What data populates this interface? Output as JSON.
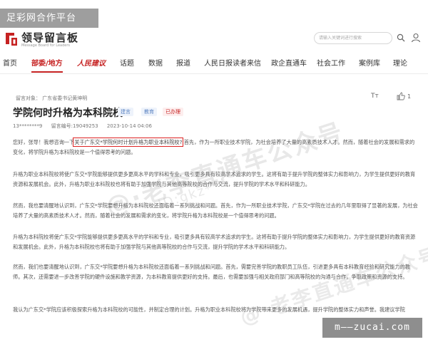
{
  "watermark_top": "足彩网合作平台",
  "watermark_bottom": "m——zucai.com",
  "watermark_overlay": {
    "line1": "@·老李直通车公众号",
    "line2": "ID:gkz***",
    "line3": "@·老李直通车公众号"
  },
  "header": {
    "logo_title": "领导留言板",
    "logo_sub": "Message Board for Leaders",
    "search_placeholder": "请输入关键词进行搜索",
    "logo_color": "#c62222"
  },
  "nav": {
    "items": [
      "首页",
      "部委/地方",
      "人民建议",
      "话题",
      "数据",
      "报道",
      "人民日报读者来信",
      "政企直通车",
      "社会工作",
      "案例库",
      "理论"
    ],
    "active_index": 1
  },
  "message": {
    "recipient": "留言对象：   广东省委书记黄坤明",
    "title": "学院何时升格为本科院校",
    "tags": [
      "建言",
      "教育",
      "已办理"
    ],
    "author": "13********9",
    "id": "留言编号:19049253",
    "time": "2023-10-14 04:06",
    "font_toggle": "Tт",
    "likes": "1",
    "paragraphs": [
      {
        "pre": "您好，张导！我想咨询一下",
        "highlight": "关于广东交*学院何时计划升格为职业本科院校?",
        "post": " 首先，作为一所职业技术学院，为社会培养了大量的高素质技术人才。然而，随着社会的发展和需求的变化，将学院升格为本科院校是一个值得思考的问题。"
      },
      {
        "pre": "升格为职业本科院校将使广东交*学院能够提供更多更高水平的学科和专业，吸引更多具有较高学术追求的学生。这将有助于提升学院的整体实力和影响力，为学生提供更好的教育资源和发展机会。此外，升格为职业本科院校也将有助于加强学院与其他高等院校的合作与交流，提升学院的学术水平和科研能力。",
        "highlight": "",
        "post": ""
      },
      {
        "pre": "然而，我也要清醒地认识到，广东交*学院要想升格为本科院校还面临着一系列挑战和问题。首先，作为一所职业技术学院，广东交*学院在过去的几年里取得了显著的发展，为社会培养了大量的高素质技术人才。然而，随着社会的发展和需求的变化，将学院升格为本科院校是一个值得思考的问题。",
        "highlight": "",
        "post": ""
      },
      {
        "pre": "升格为本科院校将使广东交*学院能够提供更多更高水平的学科和专业，吸引更多具有较高学术追求的学生。这将有助于提升学院的整体实力和影响力，为学生提供更好的教育资源和发展机会。此外，升格为本科院校也将有助于加强学院与其他高等院校的合作与交流，提升学院的学术水平和科研能力。",
        "highlight": "",
        "post": ""
      },
      {
        "pre": "然而，我们也要清醒地认识到，广东交*学院要想升格为本科院校还面临着一系列挑战和问题。首先，需要完善学院的教职员工队伍，引进更多具有本科教育经验和研究能力的教师。其次，还需要进一步改善学院的硬件设施和教学资源，为本科教育提供更好的支持。最后，也需要加强与相关政府部门和高等院校的沟通与合作，争取政策和资源的支持。",
        "highlight": "",
        "post": ""
      },
      {
        "pre": "我认为广东交*学院应该积极探索升格为本科院校的可能性，并制定合理的计划。升格为职业本科院校将为学院带来更多的发展机遇，提升学院的整体实力和声誉。我建议学院",
        "highlight": "",
        "post": ""
      }
    ]
  }
}
